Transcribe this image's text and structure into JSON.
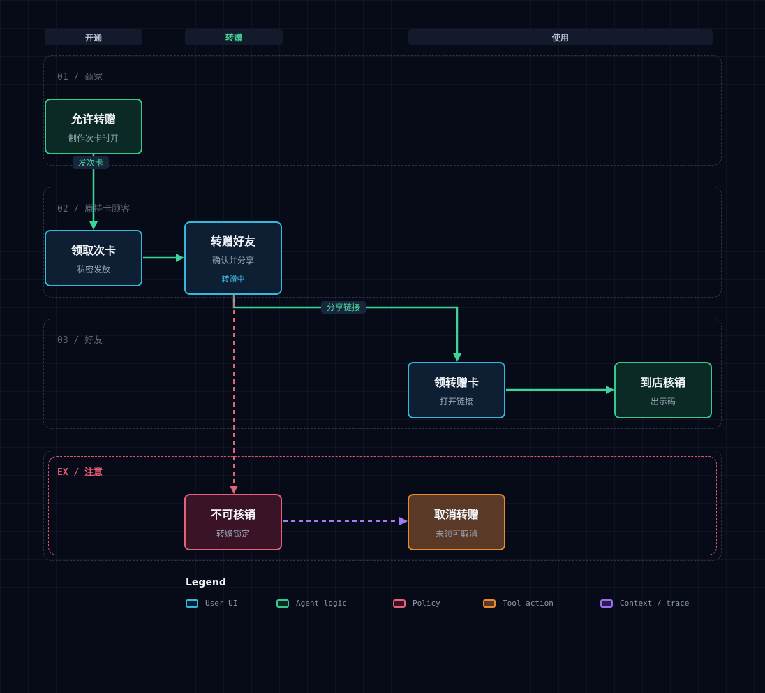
{
  "colors": {
    "background": "#070a17",
    "user_ui": "#34b8dc",
    "agent_logic": "#35c98c",
    "policy": "#e4627a",
    "tool_action": "#e88a2f",
    "context_trace": "#9b6ef0"
  },
  "phases": [
    {
      "label": "开通"
    },
    {
      "label": "转赠"
    },
    {
      "label": "使用"
    }
  ],
  "lanes": [
    {
      "label": "01 / 商家"
    },
    {
      "label": "02 / 原持卡顾客"
    },
    {
      "label": "03 / 好友"
    },
    {
      "label": "EX / 注意"
    }
  ],
  "nodes": {
    "allow_transfer": {
      "title": "允许转赠",
      "sub": "制作次卡时开",
      "kind": "Agent logic"
    },
    "receive_card": {
      "title": "领取次卡",
      "sub": "私密发放",
      "kind": "User UI"
    },
    "gift_friend": {
      "title": "转赠好友",
      "sub": "确认并分享",
      "badge": "转赠中",
      "kind": "User UI"
    },
    "claim_gift_card": {
      "title": "领转赠卡",
      "sub": "打开链接",
      "kind": "User UI"
    },
    "redeem_in_store": {
      "title": "到店核销",
      "sub": "出示码",
      "kind": "Agent logic"
    },
    "cannot_redeem": {
      "title": "不可核销",
      "sub": "转赠锁定",
      "kind": "Policy"
    },
    "cancel_transfer": {
      "title": "取消转赠",
      "sub": "未领可取消",
      "kind": "Tool action"
    }
  },
  "edges": {
    "issue_card_label": "发次卡",
    "share_link_label": "分享链接"
  },
  "legend": {
    "title": "Legend",
    "items": [
      {
        "label": "User UI",
        "color": "#34b8dc"
      },
      {
        "label": "Agent logic",
        "color": "#35c98c"
      },
      {
        "label": "Policy",
        "color": "#e4627a"
      },
      {
        "label": "Tool action",
        "color": "#e88a2f"
      },
      {
        "label": "Context / trace",
        "color": "#9b6ef0"
      }
    ]
  }
}
